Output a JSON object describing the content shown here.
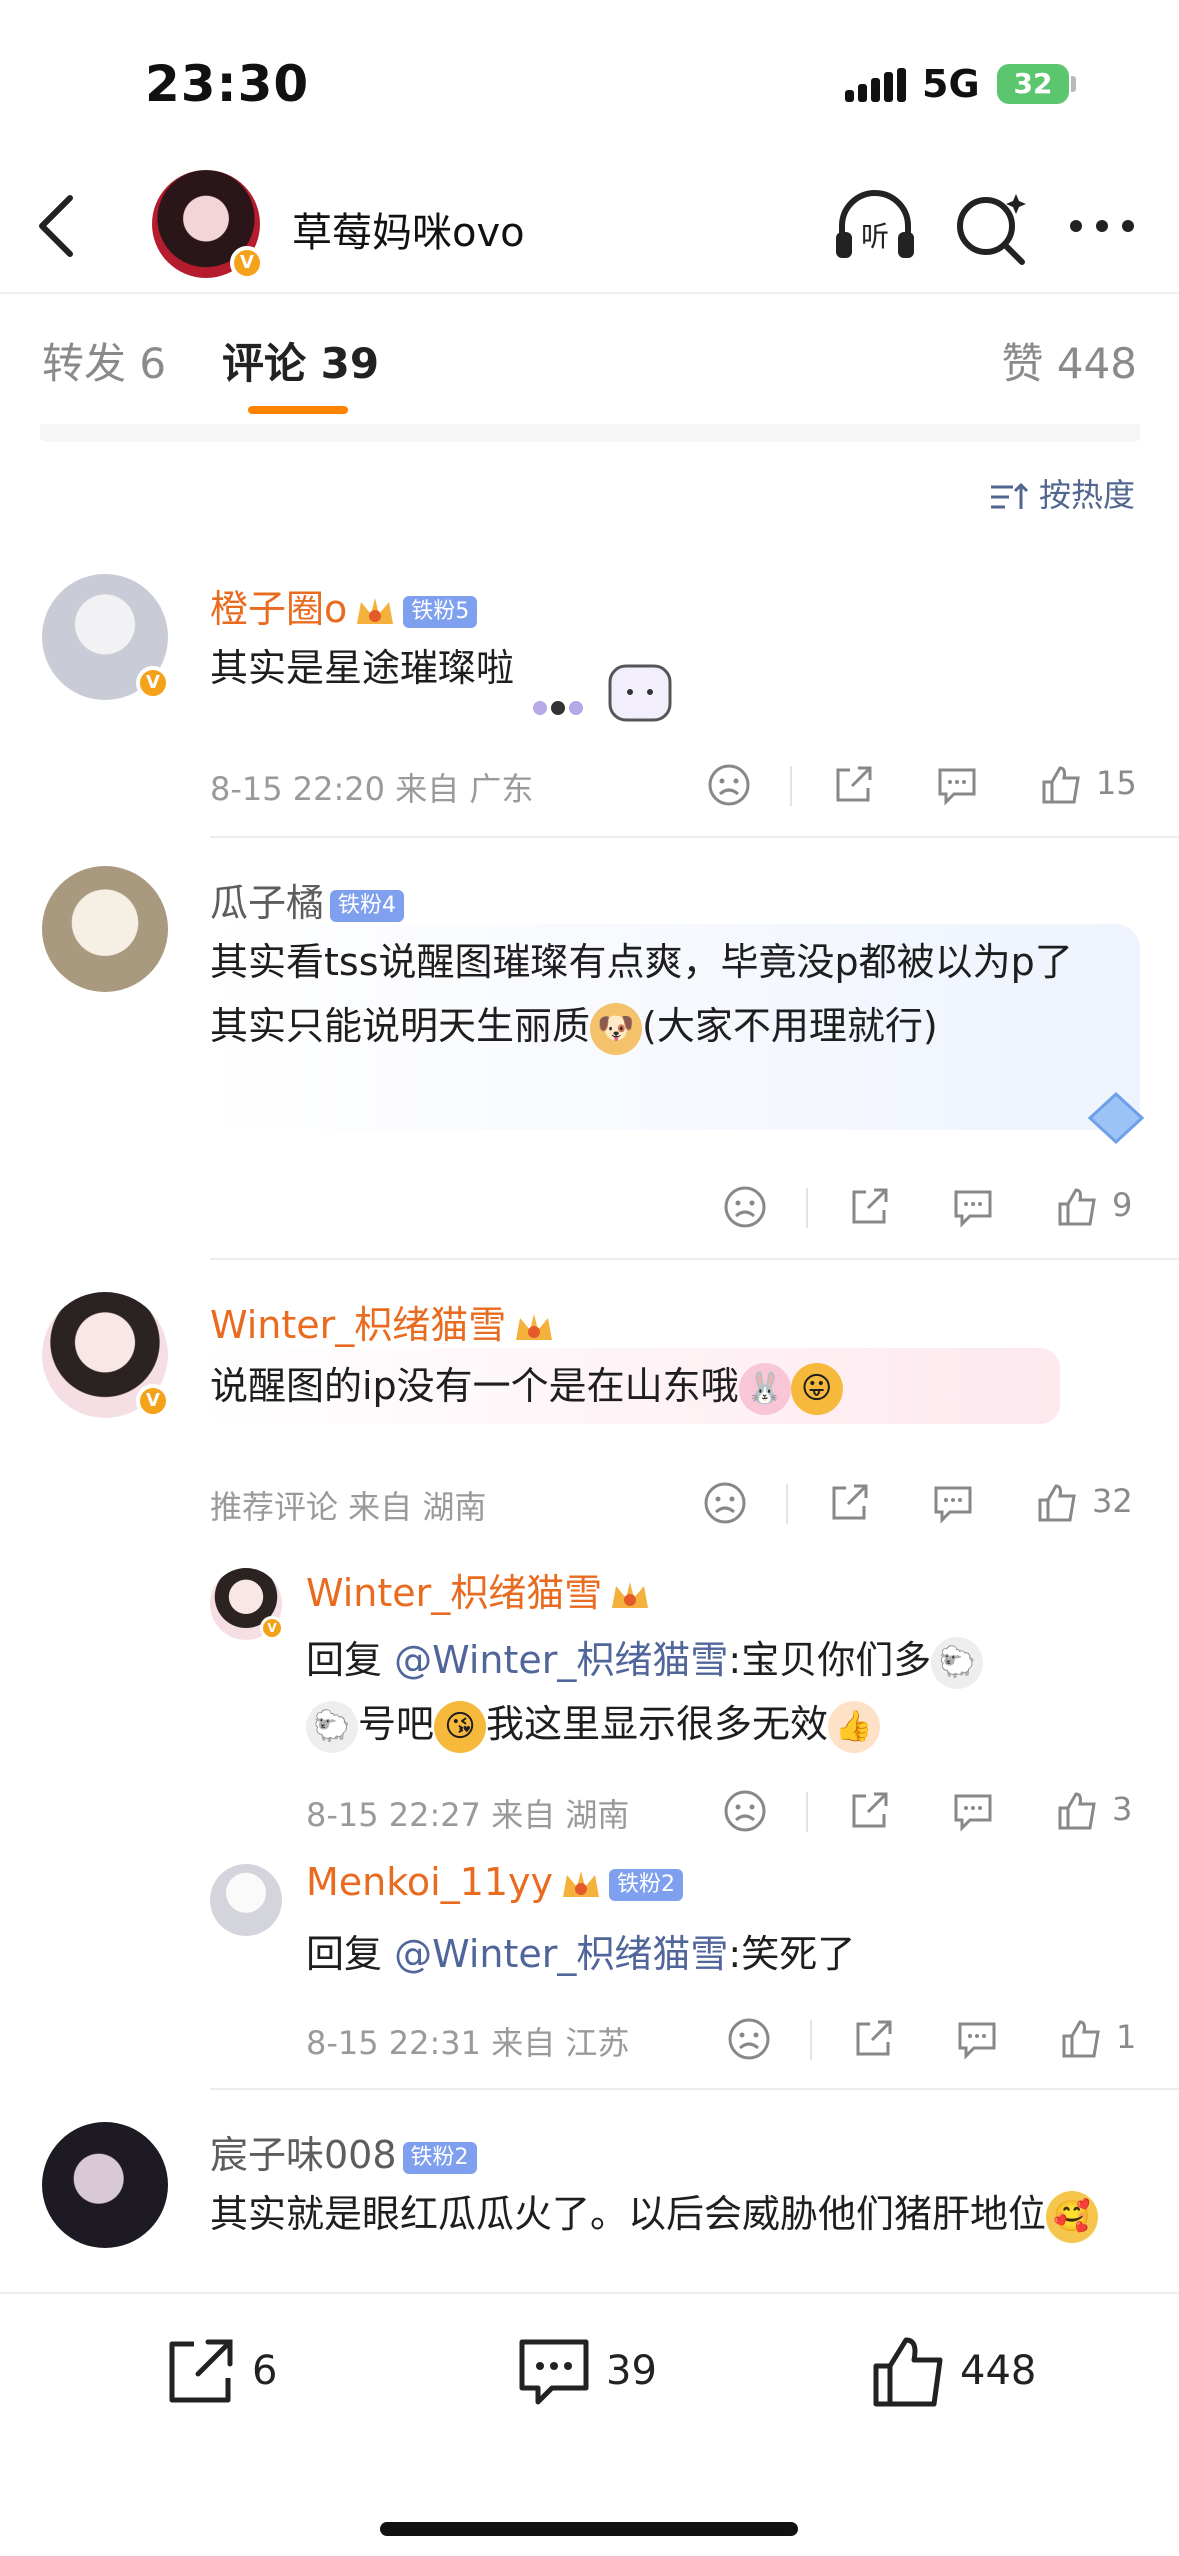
{
  "status": {
    "time": "23:30",
    "network": "5G",
    "battery": "32"
  },
  "nav": {
    "title": "草莓妈咪ovo",
    "listen_label": "听"
  },
  "tabs": {
    "repost": "转发 6",
    "comment": "评论 39",
    "likes": "赞 448"
  },
  "sort_label": "按热度",
  "comments": [
    {
      "name": "橙子圈o",
      "fan": "铁粉5",
      "text": "其实是星途璀璨啦",
      "meta": "8-15 22:20 来自 广东",
      "likes": "15"
    },
    {
      "name": "瓜子橘",
      "fan": "铁粉4",
      "text": "其实看tss说醒图璀璨有点爽，毕竟没p都被以为p了其实只能说明天生丽质",
      "text_tail": "(大家不用理就行)",
      "meta": "",
      "likes": "9"
    },
    {
      "name": "Winter_枳绪猫雪",
      "text": "说醒图的ip没有一个是在山东哦",
      "meta": "推荐评论 来自 湖南",
      "likes": "32",
      "replies": [
        {
          "name": "Winter_枳绪猫雪",
          "prefix": "回复 ",
          "mention": "@Winter_枳绪猫雪",
          "text": ":宝贝你们多",
          "text2": "号吧",
          "text3": "我这里显示很多无效",
          "meta": "8-15 22:27 来自 湖南",
          "likes": "3"
        },
        {
          "name": "Menkoi_11yy",
          "fan": "铁粉2",
          "prefix": "回复 ",
          "mention": "@Winter_枳绪猫雪",
          "text": ":笑死了",
          "meta": "8-15 22:31 来自 江苏",
          "likes": "1"
        }
      ]
    },
    {
      "name": "宸子味008",
      "fan": "铁粉2",
      "text": "其实就是眼红瓜瓜火了。以后会威胁他们猪肝地位"
    }
  ],
  "bottom": {
    "repost": "6",
    "comment": "39",
    "like": "448"
  },
  "colors": {
    "accent": "#ff8200",
    "name": "#e86b1f",
    "link": "#50669b",
    "fan_badge": "#7ea0ef"
  }
}
